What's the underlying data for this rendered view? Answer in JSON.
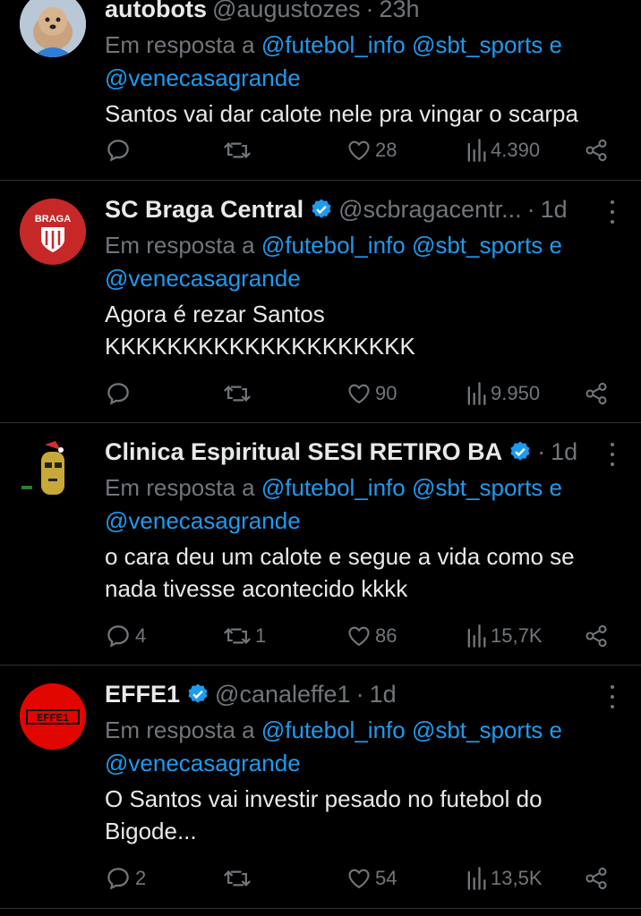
{
  "reply_prefix": "Em resposta a",
  "conjunction": "e",
  "tweets": [
    {
      "name": "autobots",
      "handle": "@augustozes",
      "time": "23h",
      "verified": false,
      "mentions": [
        "@futebol_info",
        "@sbt_sports",
        "@venecasagrande"
      ],
      "text": "Santos vai dar calote nele pra vingar o scarpa",
      "reply_count": "",
      "retweet_count": "",
      "like_count": "28",
      "view_count": "4.390"
    },
    {
      "name": "SC Braga Central",
      "handle": "@scbragacentr...",
      "time": "1d",
      "verified": true,
      "mentions": [
        "@futebol_info",
        "@sbt_sports",
        "@venecasagrande"
      ],
      "text": "Agora é rezar Santos\nKKKKKKKKKKKKKKKKKKKK",
      "reply_count": "",
      "retweet_count": "",
      "like_count": "90",
      "view_count": "9.950",
      "avatar_text": "BRAGA"
    },
    {
      "name": "Clinica Espiritual SESI RETIRO BA",
      "handle": "",
      "time": "1d",
      "verified": true,
      "mentions": [
        "@futebol_info",
        "@sbt_sports",
        "@venecasagrande"
      ],
      "text": "o cara deu um calote e segue a vida como se nada tivesse acontecido kkkk",
      "reply_count": "4",
      "retweet_count": "1",
      "like_count": "86",
      "view_count": "15,7K"
    },
    {
      "name": "EFFE1",
      "handle": "@canaleffe1",
      "time": "1d",
      "verified": true,
      "mentions": [
        "@futebol_info",
        "@sbt_sports",
        "@venecasagrande"
      ],
      "text": "O Santos vai investir pesado no futebol do Bigode...",
      "reply_count": "2",
      "retweet_count": "",
      "like_count": "54",
      "view_count": "13,5K",
      "avatar_text": "EFFE1"
    }
  ],
  "colors": {
    "background": "#000000",
    "text": "#e7e9ea",
    "muted": "#71767b",
    "link": "#1d9bf0",
    "divider": "#2f3336"
  }
}
